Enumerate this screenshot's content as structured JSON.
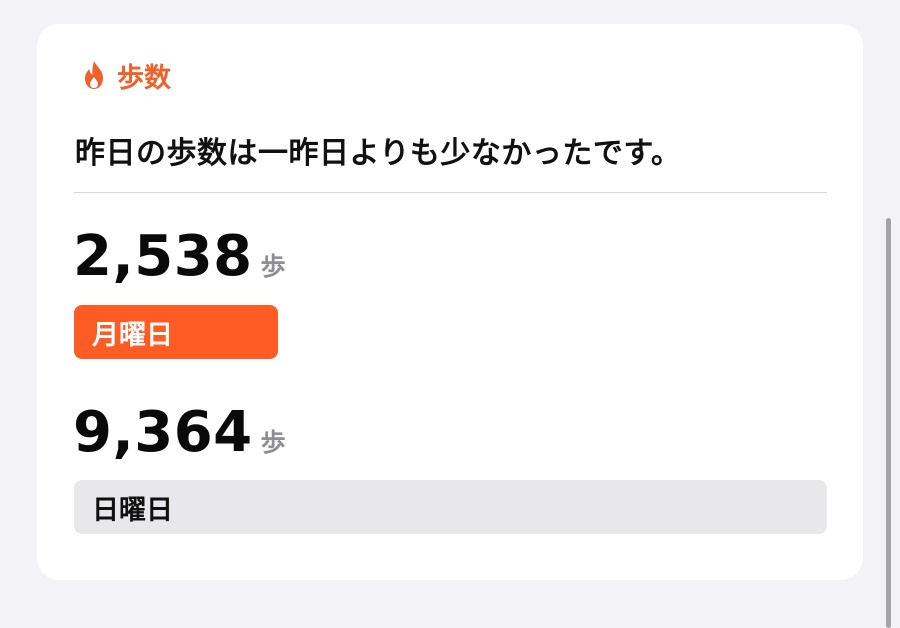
{
  "card": {
    "header": {
      "icon": "flame-icon",
      "title": "歩数",
      "accent_color": "#f2602a"
    },
    "summary": "昨日の歩数は一昨日よりも少なかったです。",
    "metrics": [
      {
        "value": "2,538",
        "unit": "歩",
        "day_label": "月曜日",
        "bar_color": "#fe5b25",
        "bar_fraction": 0.271
      },
      {
        "value": "9,364",
        "unit": "歩",
        "day_label": "日曜日",
        "bar_color": "#e8e8ea",
        "bar_fraction": 1.0
      }
    ]
  }
}
